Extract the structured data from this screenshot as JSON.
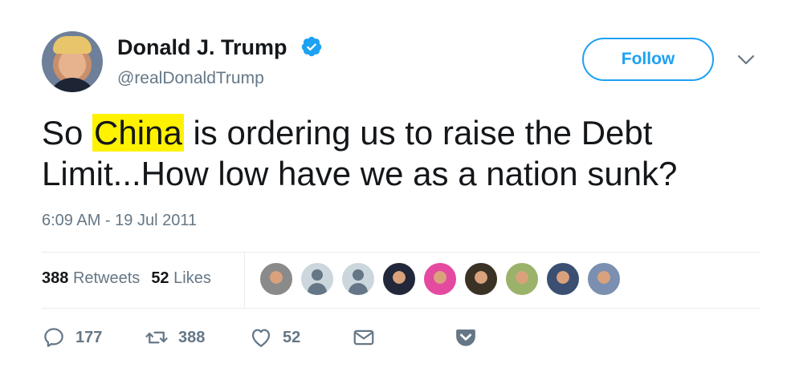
{
  "user": {
    "name": "Donald J. Trump",
    "handle": "@realDonaldTrump",
    "avatar_icon": "profile-photo",
    "verified_icon": "verified-badge-icon"
  },
  "follow_button": {
    "label": "Follow"
  },
  "tweet": {
    "text_before": "So ",
    "text_highlight": "China",
    "text_after": " is ordering us to raise the Debt Limit...How low have we as a nation sunk?",
    "timestamp": "6:09 AM - 19 Jul 2011"
  },
  "stats": {
    "retweets_count": "388",
    "retweets_label": "Retweets",
    "likes_count": "52",
    "likes_label": "Likes"
  },
  "likers": [
    {
      "name": "liker-avatar-1",
      "color": "#8a8a8a"
    },
    {
      "name": "liker-avatar-2",
      "color": "default"
    },
    {
      "name": "liker-avatar-3",
      "color": "default"
    },
    {
      "name": "liker-avatar-4",
      "color": "#22283a"
    },
    {
      "name": "liker-avatar-5",
      "color": "#e44ba0"
    },
    {
      "name": "liker-avatar-6",
      "color": "#3b3226"
    },
    {
      "name": "liker-avatar-7",
      "color": "#9bb26a"
    },
    {
      "name": "liker-avatar-8",
      "color": "#3b4f73"
    },
    {
      "name": "liker-avatar-9",
      "color": "#7b8fb0"
    }
  ],
  "actions": {
    "reply_count": "177",
    "retweet_count": "388",
    "like_count": "52"
  },
  "colors": {
    "accent": "#1da1f2",
    "muted": "#657786",
    "text": "#14171a",
    "highlight": "#fff200"
  }
}
